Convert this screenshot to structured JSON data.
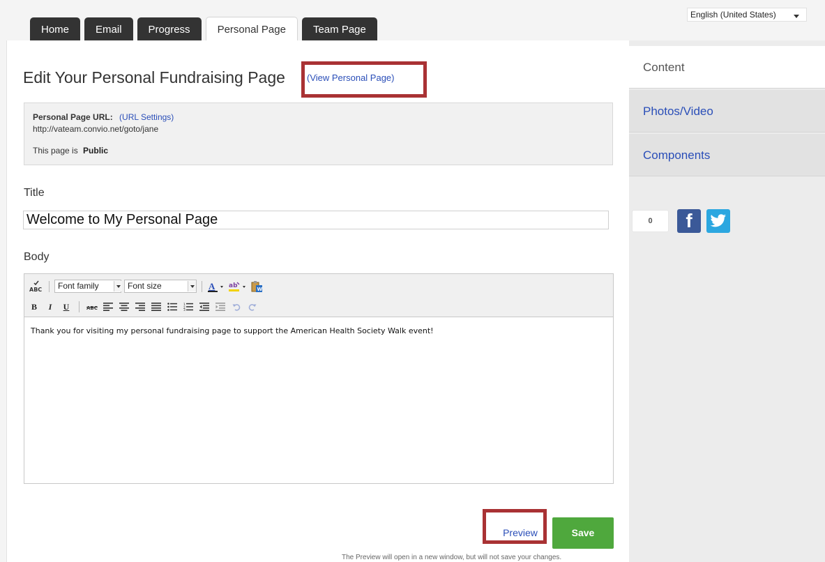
{
  "tabs": [
    {
      "label": "Home",
      "active": false
    },
    {
      "label": "Email",
      "active": false
    },
    {
      "label": "Progress",
      "active": false
    },
    {
      "label": "Personal Page",
      "active": true
    },
    {
      "label": "Team Page",
      "active": false
    }
  ],
  "language": {
    "selected": "English (United States)"
  },
  "header": {
    "title": "Edit Your Personal Fundraising Page",
    "view_link": "(View Personal Page)"
  },
  "url_box": {
    "label": "Personal Page URL:",
    "settings_link": "(URL Settings)",
    "url": "http://vateam.convio.net/goto/jane",
    "visibility_prefix": "This page is",
    "visibility_value": "Public"
  },
  "title_field": {
    "label": "Title",
    "value": "Welcome to My Personal Page"
  },
  "body_field": {
    "label": "Body",
    "font_family_placeholder": "Font family",
    "font_size_placeholder": "Font size",
    "content": "Thank you for visiting my personal fundraising page to support the American Health Society Walk event!"
  },
  "sidebar": {
    "items": [
      {
        "label": "Content",
        "active": true
      },
      {
        "label": "Photos/Video",
        "active": false
      },
      {
        "label": "Components",
        "active": false
      }
    ]
  },
  "social": {
    "share_count": "0"
  },
  "actions": {
    "preview_label": "Preview",
    "save_label": "Save",
    "note": "The Preview will open in a new window, but will not save your changes."
  },
  "colors": {
    "link": "#2a4eb8",
    "save": "#4fa83d",
    "highlight_box": "#a93234",
    "tab_dark": "#333333",
    "facebook": "#3b5998",
    "twitter": "#2ca7e0"
  }
}
